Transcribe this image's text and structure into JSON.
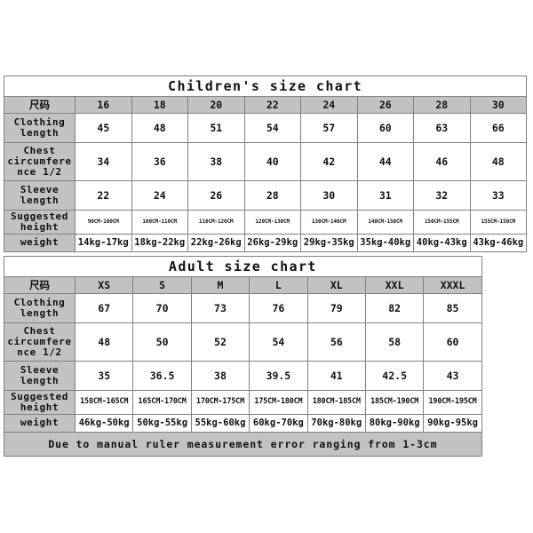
{
  "document": {
    "background_color": "#ffffff",
    "header_fill_color": "#c2c2c2",
    "border_color": "#808080",
    "text_color": "#111111"
  },
  "children_chart": {
    "title": "Children's size chart",
    "size_label": "尺码",
    "sizes": [
      "16",
      "18",
      "20",
      "22",
      "24",
      "26",
      "28",
      "30"
    ],
    "rows": [
      {
        "label": "Clothing length",
        "values": [
          "45",
          "48",
          "51",
          "54",
          "57",
          "60",
          "63",
          "66"
        ]
      },
      {
        "label": "Chest circumference 1/2",
        "values": [
          "34",
          "36",
          "38",
          "40",
          "42",
          "44",
          "46",
          "48"
        ]
      },
      {
        "label": "Sleeve length",
        "values": [
          "22",
          "24",
          "26",
          "28",
          "30",
          "31",
          "32",
          "33"
        ]
      },
      {
        "label": "Suggested height",
        "values": [
          "90CM-100CM",
          "100CM-110CM",
          "110CM-120CM",
          "120CM-130CM",
          "130CM-140CM",
          "140CM-150CM",
          "150CM-155CM",
          "155CM-158CM"
        ]
      },
      {
        "label": "weight",
        "values": [
          "14kg-17kg",
          "18kg-22kg",
          "22kg-26kg",
          "26kg-29kg",
          "29kg-35kg",
          "35kg-40kg",
          "40kg-43kg",
          "43kg-46kg"
        ]
      }
    ]
  },
  "adult_chart": {
    "title": "Adult size chart",
    "size_label": "尺码",
    "sizes": [
      "XS",
      "S",
      "M",
      "L",
      "XL",
      "XXL",
      "XXXL"
    ],
    "rows": [
      {
        "label": "Clothing length",
        "values": [
          "67",
          "70",
          "73",
          "76",
          "79",
          "82",
          "85"
        ]
      },
      {
        "label": "Chest circumference 1/2",
        "values": [
          "48",
          "50",
          "52",
          "54",
          "56",
          "58",
          "60"
        ]
      },
      {
        "label": "Sleeve length",
        "values": [
          "35",
          "36.5",
          "38",
          "39.5",
          "41",
          "42.5",
          "43"
        ]
      },
      {
        "label": "Suggested height",
        "values": [
          "158CM-165CM",
          "165CM-170CM",
          "170CM-175CM",
          "175CM-180CM",
          "180CM-185CM",
          "185CM-190CM",
          "190CM-195CM"
        ]
      },
      {
        "label": "weight",
        "values": [
          "46kg-50kg",
          "50kg-55kg",
          "55kg-60kg",
          "60kg-70kg",
          "70kg-80kg",
          "80kg-90kg",
          "90kg-95kg"
        ]
      }
    ],
    "note": "Due to manual ruler measurement error ranging from 1-3cm"
  }
}
